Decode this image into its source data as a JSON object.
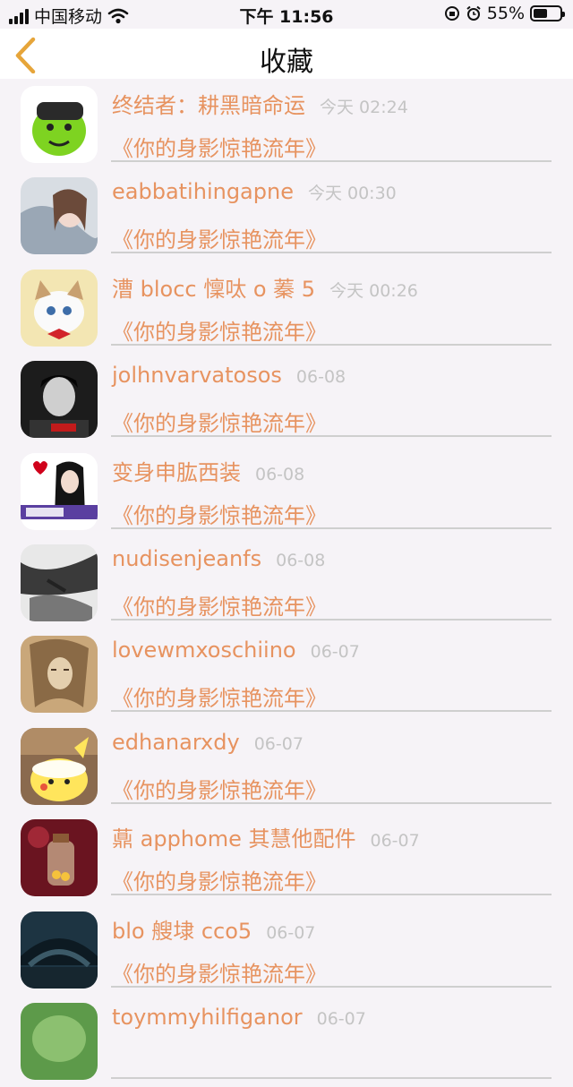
{
  "status_bar": {
    "carrier": "中国移动",
    "time": "下午 11:56",
    "battery": "55%",
    "battery_level": 0.55
  },
  "header": {
    "title": "收藏",
    "back_icon": "chevron-left-icon",
    "accent": "#e79360"
  },
  "items": [
    {
      "name": "终结者：耕黑暗命运",
      "time": "今天 02:24",
      "song": "《你的身影惊艳流年》"
    },
    {
      "name": "eabbatihingapne",
      "time": "今天 00:30",
      "song": "《你的身影惊艳流年》"
    },
    {
      "name": "漕 blocc 懍呔 o 蓁 5",
      "time": "今天 00:26",
      "song": "《你的身影惊艳流年》"
    },
    {
      "name": "jolhnvarvatosos",
      "time": "06-08",
      "song": "《你的身影惊艳流年》"
    },
    {
      "name": "变身申肱西装",
      "time": "06-08",
      "song": "《你的身影惊艳流年》"
    },
    {
      "name": "nudisenjeanfs",
      "time": "06-08",
      "song": "《你的身影惊艳流年》"
    },
    {
      "name": "lovewmxoschiino",
      "time": "06-07",
      "song": "《你的身影惊艳流年》"
    },
    {
      "name": "edhanarxdy",
      "time": "06-07",
      "song": "《你的身影惊艳流年》"
    },
    {
      "name": "薡 apphome 其慧他配件",
      "time": "06-07",
      "song": "《你的身影惊艳流年》"
    },
    {
      "name": "blo 艘埭 cco5",
      "time": "06-07",
      "song": "《你的身影惊艳流年》"
    },
    {
      "name": "toymmyhilfiganor",
      "time": "06-07",
      "song": ""
    }
  ]
}
